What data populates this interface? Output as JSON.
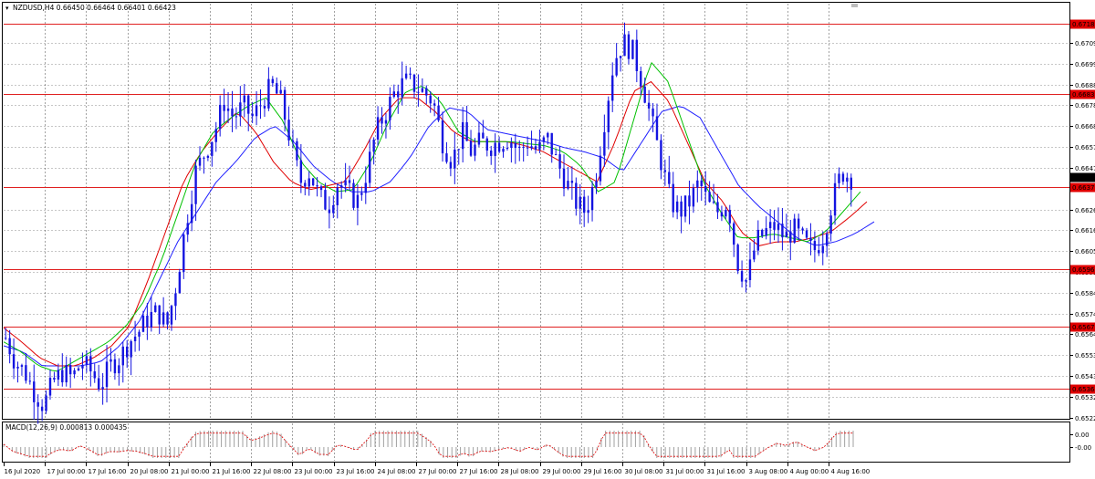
{
  "window": {
    "symbol_header": "NZDUSD,H4  0.66450 0.66464 0.66401 0.66423",
    "indicator_header": "MACD(12,26,9) 0.000813 0.000435"
  },
  "colors": {
    "candles": "#1414e0",
    "ma_fast": "#00c000",
    "ma_mid": "#e00000",
    "ma_slow": "#2020ff",
    "level_line": "#e02020",
    "level_tag_bg": "#e00000",
    "current_tag_bg": "#000000",
    "grid": "#000000",
    "macd_hist": "#a0a0a0",
    "macd_signal": "#e00000"
  },
  "chart_data": {
    "type": "candlestick",
    "symbol": "NZDUSD",
    "timeframe": "H4",
    "ylim": [
      0.6522,
      0.6729
    ],
    "y_ticks": [
      "0.67095",
      "0.66990",
      "0.66885",
      "0.66785",
      "0.66680",
      "0.66575",
      "0.66470",
      "0.66260",
      "0.66160",
      "0.66055",
      "0.65950",
      "0.65845",
      "0.65740",
      "0.65640",
      "0.65535",
      "0.65430",
      "0.65325",
      "0.65220"
    ],
    "x_ticks": [
      "16 Jul 2020",
      "17 Jul 00:00",
      "17 Jul 16:00",
      "20 Jul 08:00",
      "21 Jul 00:00",
      "21 Jul 16:00",
      "22 Jul 08:00",
      "23 Jul 00:00",
      "23 Jul 16:00",
      "24 Jul 08:00",
      "27 Jul 00:00",
      "27 Jul 16:00",
      "28 Jul 08:00",
      "29 Jul 00:00",
      "29 Jul 16:00",
      "30 Jul 08:00",
      "31 Jul 00:00",
      "31 Jul 16:00",
      "3 Aug 08:00",
      "4 Aug 00:00",
      "4 Aug 16:00"
    ],
    "price_levels": [
      "0.67188",
      "0.66837",
      "0.66373",
      "0.65963",
      "0.65677",
      "0.65364"
    ],
    "current_price": "0.66423",
    "close_path": [
      0.6562,
      0.655,
      0.6545,
      0.6535,
      0.6528,
      0.654,
      0.6545,
      0.6542,
      0.655,
      0.6545,
      0.6538,
      0.6548,
      0.6552,
      0.656,
      0.6565,
      0.6572,
      0.6575,
      0.6568,
      0.659,
      0.662,
      0.6645,
      0.6655,
      0.6665,
      0.668,
      0.6672,
      0.6678,
      0.6672,
      0.668,
      0.6688,
      0.668,
      0.666,
      0.664,
      0.6645,
      0.6632,
      0.6628,
      0.664,
      0.6635,
      0.663,
      0.6645,
      0.6665,
      0.6675,
      0.6685,
      0.669,
      0.6688,
      0.6685,
      0.668,
      0.666,
      0.665,
      0.6665,
      0.6655,
      0.666,
      0.6658,
      0.666,
      0.6662,
      0.6655,
      0.666,
      0.6655,
      0.6662,
      0.665,
      0.664,
      0.663,
      0.6625,
      0.664,
      0.667,
      0.67,
      0.671,
      0.6705,
      0.669,
      0.667,
      0.665,
      0.663,
      0.6625,
      0.663,
      0.664,
      0.6628,
      0.6625,
      0.663,
      0.66,
      0.659,
      0.661,
      0.6615,
      0.6618,
      0.6612,
      0.6616,
      0.661,
      0.6605,
      0.6612,
      0.663,
      0.6645,
      0.6642
    ],
    "ma_fast_path": [
      0.656,
      0.6555,
      0.6548,
      0.6545,
      0.655,
      0.6555,
      0.656,
      0.6568,
      0.658,
      0.66,
      0.6625,
      0.665,
      0.6665,
      0.6672,
      0.6678,
      0.6682,
      0.667,
      0.665,
      0.664,
      0.6635,
      0.6636,
      0.665,
      0.667,
      0.6685,
      0.6688,
      0.668,
      0.6665,
      0.666,
      0.666,
      0.666,
      0.6659,
      0.6658,
      0.6655,
      0.6648,
      0.6635,
      0.664,
      0.667,
      0.67,
      0.669,
      0.6665,
      0.664,
      0.6625,
      0.6612,
      0.6612,
      0.6614,
      0.6612,
      0.661,
      0.6615,
      0.6625,
      0.6635
    ],
    "ma_mid_path": [
      0.6567,
      0.656,
      0.6552,
      0.6548,
      0.6548,
      0.6552,
      0.6558,
      0.6568,
      0.659,
      0.6615,
      0.664,
      0.6655,
      0.6666,
      0.6675,
      0.6665,
      0.665,
      0.664,
      0.6636,
      0.6638,
      0.664,
      0.6655,
      0.6672,
      0.6682,
      0.6682,
      0.6675,
      0.6665,
      0.666,
      0.666,
      0.666,
      0.6658,
      0.6655,
      0.665,
      0.6645,
      0.664,
      0.666,
      0.6685,
      0.669,
      0.668,
      0.666,
      0.664,
      0.663,
      0.6615,
      0.6608,
      0.661,
      0.661,
      0.6612,
      0.6615,
      0.6622,
      0.663
    ],
    "ma_slow_path": [
      0.6558,
      0.6555,
      0.6548,
      0.6548,
      0.6548,
      0.655,
      0.6558,
      0.657,
      0.659,
      0.661,
      0.6625,
      0.664,
      0.665,
      0.6662,
      0.6668,
      0.666,
      0.6648,
      0.664,
      0.6635,
      0.6635,
      0.664,
      0.6652,
      0.6668,
      0.6677,
      0.6675,
      0.6666,
      0.6664,
      0.6662,
      0.666,
      0.6657,
      0.6655,
      0.6652,
      0.6645,
      0.666,
      0.6675,
      0.6678,
      0.6672,
      0.6655,
      0.6638,
      0.6628,
      0.662,
      0.6612,
      0.6608,
      0.661,
      0.6614,
      0.662
    ],
    "macd_ticks": [
      "0.00",
      "-0.00"
    ]
  }
}
